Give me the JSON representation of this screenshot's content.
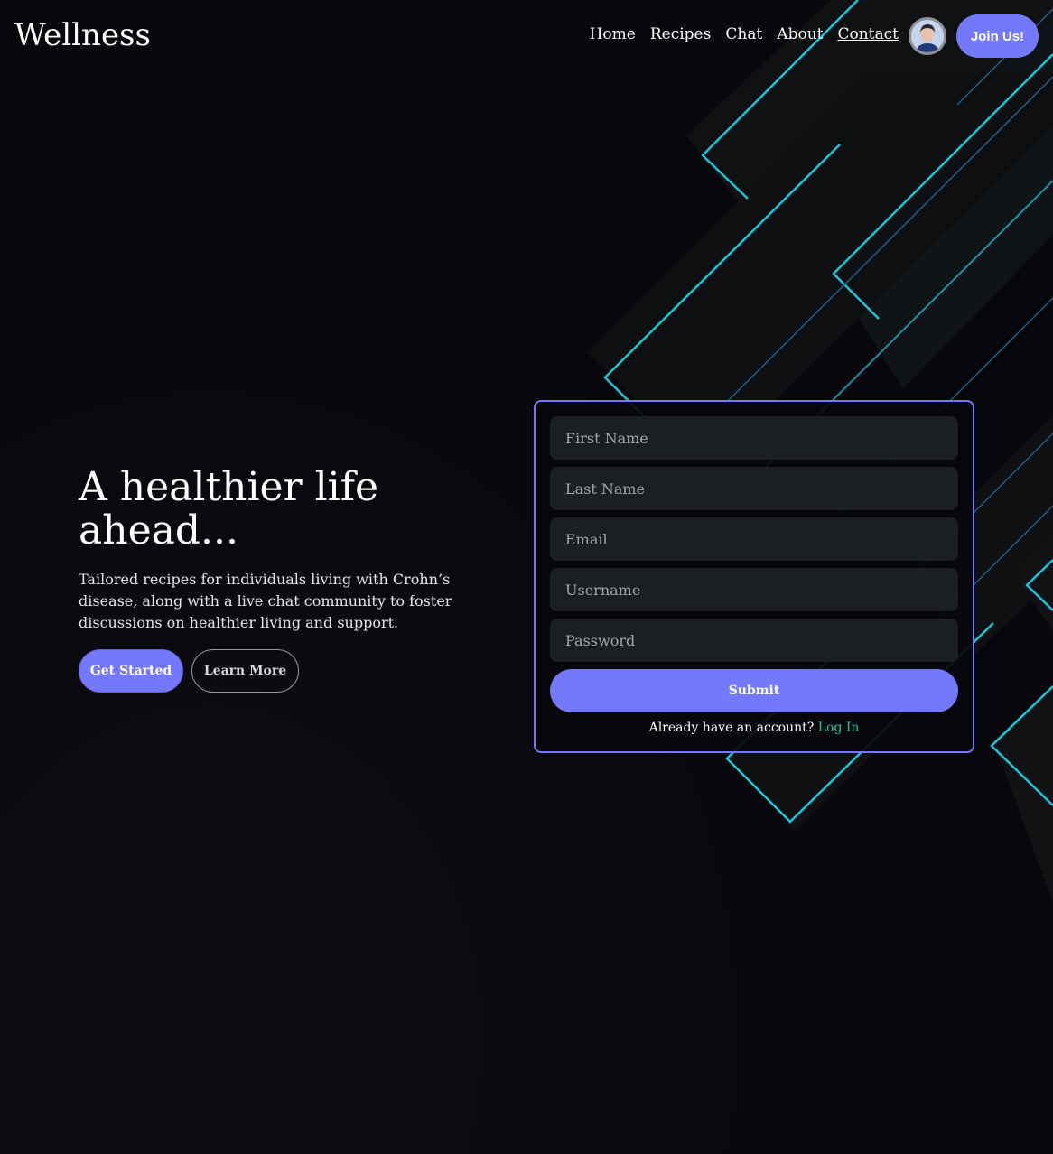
{
  "header": {
    "logo": "Wellness",
    "nav": [
      "Home",
      "Recipes",
      "Chat",
      "About",
      "Contact"
    ],
    "current_nav": "Contact",
    "join_label": "Join Us!"
  },
  "hero": {
    "title": "A healthier life ahead...",
    "subtitle": "Tailored recipes for individuals living with Crohn’s disease, along with a live chat community to foster discussions on healthier living and support.",
    "primary_label": "Get Started",
    "secondary_label": "Learn More"
  },
  "signup": {
    "first_name_placeholder": "First Name",
    "last_name_placeholder": "Last Name",
    "email_placeholder": "Email",
    "username_placeholder": "Username",
    "password_placeholder": "Password",
    "submit_label": "Submit",
    "login_prompt": "Already have an account?",
    "login_link": "Log In"
  },
  "colors": {
    "accent": "#7479fb",
    "link": "#23c5a8",
    "cyan_line": "#19c6d9",
    "background": "#08070b",
    "field_bg": "#1b1f24"
  }
}
